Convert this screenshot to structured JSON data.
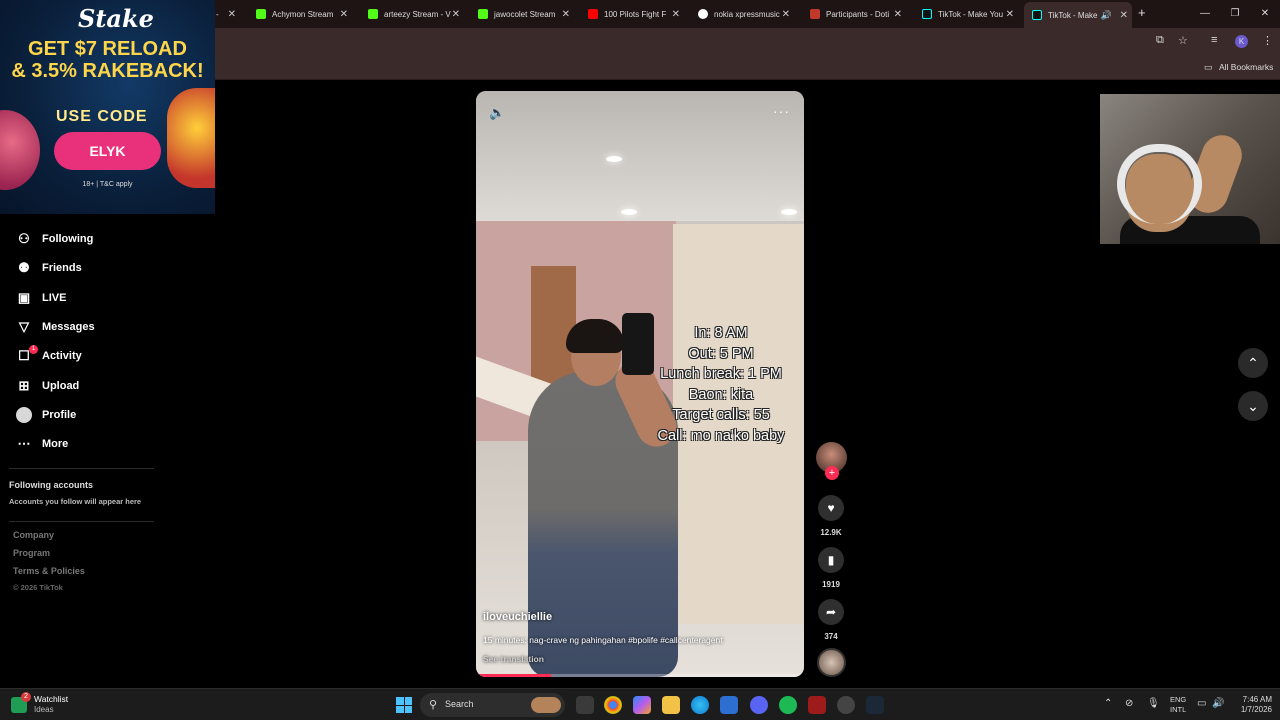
{
  "browser": {
    "tabs": [
      {
        "label": "-",
        "color": "#4d4d4d"
      },
      {
        "label": "Achymon Stream",
        "color": "#53fc18"
      },
      {
        "label": "arteezy Stream - V",
        "color": "#53fc18"
      },
      {
        "label": "jawocolet Stream",
        "color": "#53fc18"
      },
      {
        "label": "100 Pilots Fight F",
        "color": "#ff0000"
      },
      {
        "label": "nokia xpressmusic",
        "color": "#ffffff"
      },
      {
        "label": "Participants - Doti",
        "color": "#c0392b"
      },
      {
        "label": "TikTok - Make You",
        "color": "#111111"
      },
      {
        "label": "TikTok - Make",
        "color": "#111111"
      }
    ],
    "bookmarks_label": "All Bookmarks",
    "profile_initial": "K"
  },
  "ad": {
    "brand": "Stake",
    "headline_1": "GET $7 RELOAD",
    "headline_2": "& 3.5% RAKEBACK!",
    "use_code": "USE CODE",
    "code": "ELYK",
    "terms": "18+ | T&C apply"
  },
  "sidebar": {
    "items": [
      {
        "label": "Following",
        "icon": "following-icon"
      },
      {
        "label": "Friends",
        "icon": "friends-icon"
      },
      {
        "label": "LIVE",
        "icon": "live-icon"
      },
      {
        "label": "Messages",
        "icon": "messages-icon"
      },
      {
        "label": "Activity",
        "icon": "activity-icon"
      },
      {
        "label": "Upload",
        "icon": "upload-icon"
      },
      {
        "label": "Profile",
        "icon": "profile-avatar"
      },
      {
        "label": "More",
        "icon": "more-icon"
      }
    ],
    "activity_badge": "1",
    "following_title": "Following accounts",
    "following_sub": "Accounts you follow will appear here",
    "footer": [
      "Company",
      "Program",
      "Terms & Policies"
    ],
    "copyright": "© 2026 TikTok"
  },
  "video": {
    "overlay_lines": [
      "In: 8 AM",
      "Out: 5 PM",
      "Lunch break: 1 PM",
      "Baon: kita",
      "Target calls: 55",
      "Call: mo na'ko baby"
    ],
    "username": "iloveuchiellie",
    "caption": "15 minutes: nag-crave ng pahingahan #bpolife #callcenteragent",
    "see_translation": "See translation",
    "progress": 0.23
  },
  "actions": {
    "likes": "12.9K",
    "saves": "1919",
    "shares": "374"
  },
  "taskbar": {
    "watchlist_title": "Watchlist",
    "watchlist_sub": "Ideas",
    "watchlist_badge": "2",
    "search_label": "Search",
    "lang_1": "ENG",
    "lang_2": "INTL",
    "time": "7:46 AM",
    "date": "1/7/2026"
  }
}
